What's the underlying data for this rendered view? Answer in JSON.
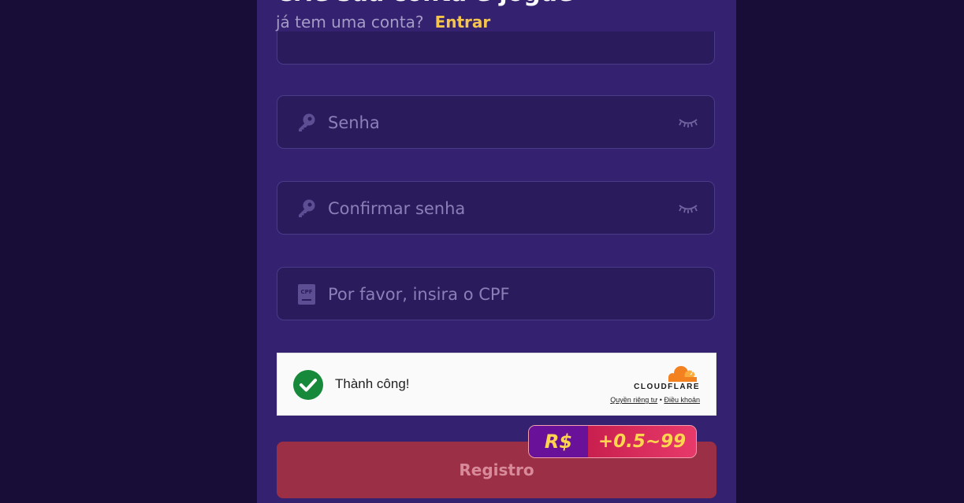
{
  "header": {
    "title": "Crie sua conta e jogue",
    "login_prompt": "já tem uma conta?",
    "login_link": "Entrar"
  },
  "form": {
    "password": {
      "placeholder": "Senha",
      "icon": "key-icon",
      "toggle_icon": "eye-closed-icon"
    },
    "confirm_password": {
      "placeholder": "Confirmar senha",
      "icon": "key-icon",
      "toggle_icon": "eye-closed-icon"
    },
    "cpf": {
      "placeholder": "Por favor, insira o CPF",
      "icon": "cpf-card-icon",
      "icon_text": "CPF"
    }
  },
  "captcha": {
    "status": "Thành công!",
    "provider": "CLOUDFLARE",
    "privacy_link": "Quyền riêng tư",
    "separator": "•",
    "terms_link": "Điều khoản"
  },
  "register_button": "Registro",
  "bonus_badge": {
    "currency": "R$",
    "amount": "+0.5~99"
  },
  "colors": {
    "page_bg": "#170d36",
    "panel_bg": "#34216f",
    "accent_gold": "#f5c44e",
    "register_bg": "#9b2f45",
    "success_green": "#168a3a"
  }
}
